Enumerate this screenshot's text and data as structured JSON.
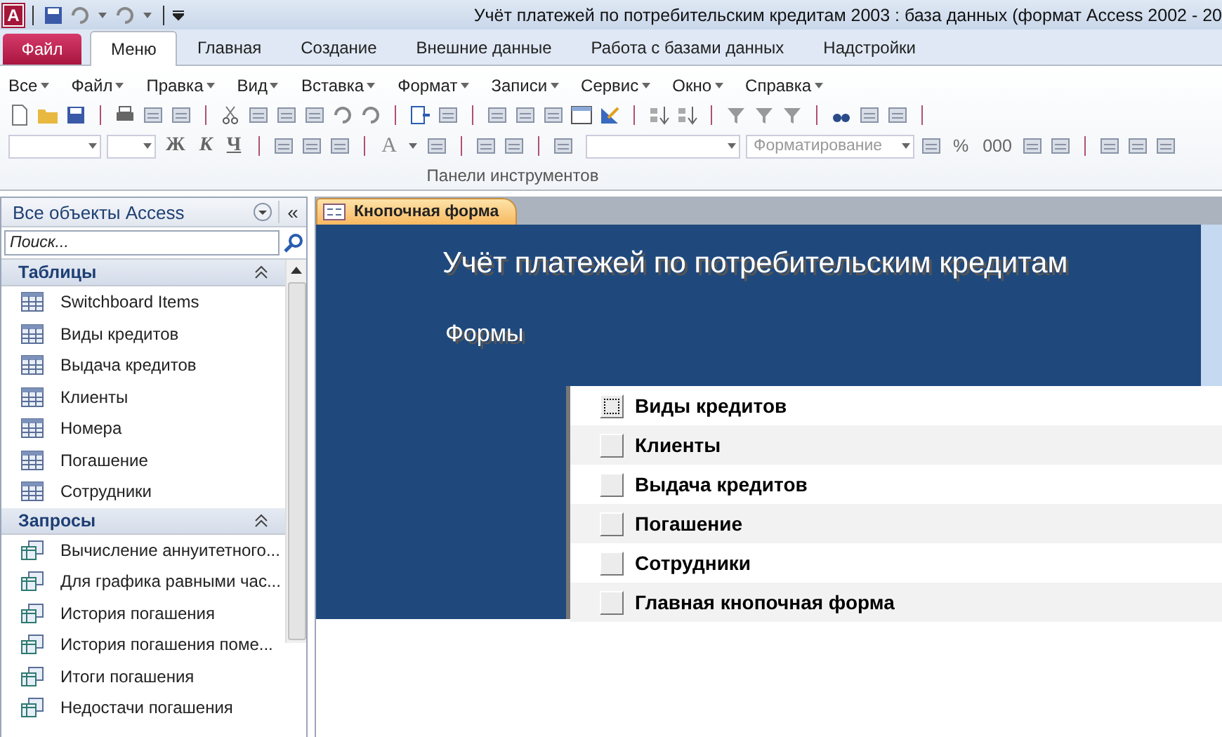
{
  "window": {
    "app_letter": "A",
    "title": "Учёт платежей по потребительским кредитам 2003 : база данных (формат Access 2002 - 20"
  },
  "ribbon_tabs": [
    {
      "label": "Файл",
      "kind": "file",
      "selected": false
    },
    {
      "label": "Меню",
      "kind": "tab",
      "selected": true
    },
    {
      "label": "Главная",
      "kind": "tab",
      "selected": false
    },
    {
      "label": "Создание",
      "kind": "tab",
      "selected": false
    },
    {
      "label": "Внешние данные",
      "kind": "tab",
      "selected": false
    },
    {
      "label": "Работа с базами данных",
      "kind": "tab",
      "selected": false
    },
    {
      "label": "Надстройки",
      "kind": "tab",
      "selected": false
    }
  ],
  "menu_bar": [
    "Все",
    "Файл",
    "Правка",
    "Вид",
    "Вставка",
    "Формат",
    "Записи",
    "Сервис",
    "Окно",
    "Справка"
  ],
  "format_toolbar": {
    "bold": "Ж",
    "italic": "К",
    "underline": "Ч",
    "font_color": "A",
    "conditional_format": {
      "label": "Форматирование",
      "disabled": true
    },
    "percent": "%",
    "thousands": "000"
  },
  "ribbon_group_label": "Панели инструментов",
  "nav_pane": {
    "title": "Все объекты Access",
    "collapse": "«",
    "search": {
      "placeholder": "Поиск..."
    },
    "groups": [
      {
        "label": "Таблицы",
        "kind": "table",
        "items": [
          "Switchboard Items",
          "Виды кредитов",
          "Выдача кредитов",
          "Клиенты",
          "Номера",
          "Погашение",
          "Сотрудники"
        ]
      },
      {
        "label": "Запросы",
        "kind": "query",
        "items": [
          "Вычисление аннуитетного...",
          "Для графика равными час...",
          "История погашения",
          "История погашения поме...",
          "Итоги погашения",
          "Недостачи погашения"
        ]
      }
    ]
  },
  "document_tab": {
    "label": "Кнопочная форма",
    "selected": true
  },
  "form": {
    "title": "Учёт платежей по потребительским кредитам",
    "subtitle": "Формы",
    "buttons": [
      {
        "label": "Виды кредитов",
        "focused": true
      },
      {
        "label": "Клиенты",
        "focused": false
      },
      {
        "label": "Выдача кредитов",
        "focused": false
      },
      {
        "label": "Погашение",
        "focused": false
      },
      {
        "label": "Сотрудники",
        "focused": false
      },
      {
        "label": "Главная кнопочная форма",
        "focused": false
      }
    ]
  }
}
